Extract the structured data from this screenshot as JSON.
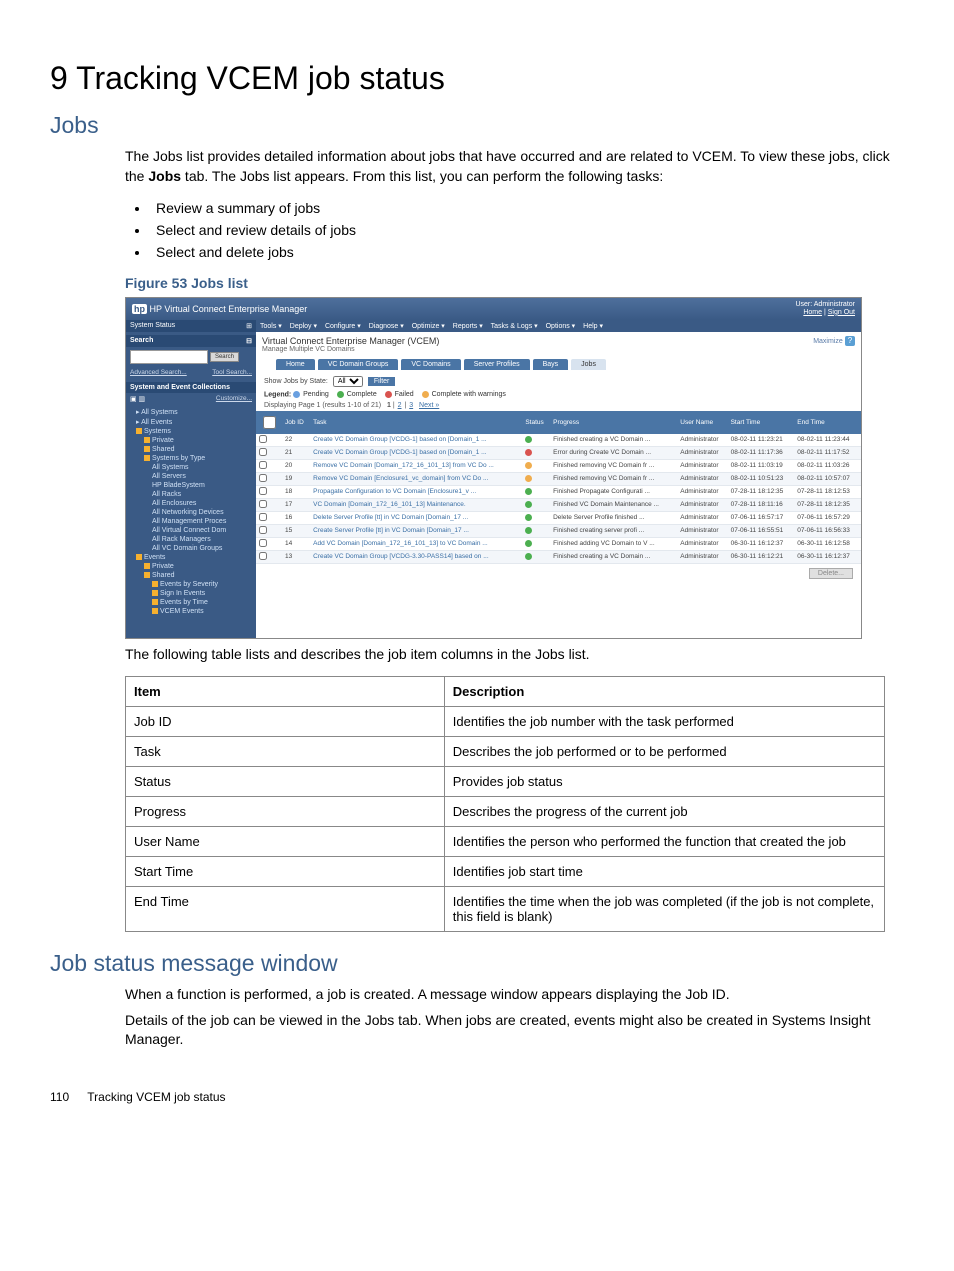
{
  "page": {
    "title": "9 Tracking VCEM job status",
    "section_jobs": "Jobs",
    "intro": "The Jobs list provides detailed information about jobs that have occurred and are related to VCEM. To view these jobs, click the ",
    "intro_bold": "Jobs",
    "intro2": " tab. The Jobs list appears. From this list, you can perform the following tasks:",
    "tasks": [
      "Review a summary of jobs",
      "Select and review details of jobs",
      "Select and delete jobs"
    ],
    "figure_caption": "Figure 53 Jobs list",
    "after_figure": "The following table lists and describes the job item columns in the Jobs list.",
    "section_status": "Job status message window",
    "status_p1": "When a function is performed, a job is created. A message window appears displaying the Job ID.",
    "status_p2": "Details of the job can be viewed in the Jobs tab. When jobs are created, events might also be created in Systems Insight Manager.",
    "footer_num": "110",
    "footer_text": "Tracking VCEM job status"
  },
  "desc_table": {
    "h1": "Item",
    "h2": "Description",
    "rows": [
      {
        "item": "Job ID",
        "desc": "Identifies the job number with the task performed"
      },
      {
        "item": "Task",
        "desc": "Describes the job performed or to be performed"
      },
      {
        "item": "Status",
        "desc": "Provides job status"
      },
      {
        "item": "Progress",
        "desc": "Describes the progress of the current job"
      },
      {
        "item": "User Name",
        "desc": "Identifies the person who performed the function that created the job"
      },
      {
        "item": "Start Time",
        "desc": "Identifies job start time"
      },
      {
        "item": "End Time",
        "desc": "Identifies the time when the job was completed (if the job is not complete, this field is blank)"
      }
    ]
  },
  "app": {
    "title": "HP Virtual Connect Enterprise Manager",
    "user_label": "User: Administrator",
    "home_link": "Home",
    "signout_link": "Sign Out",
    "system_status": "System Status",
    "menubar": [
      "Tools ▾",
      "Deploy ▾",
      "Configure ▾",
      "Diagnose ▾",
      "Optimize ▾",
      "Reports ▾",
      "Tasks & Logs ▾",
      "Options ▾",
      "Help ▾"
    ],
    "sidebar": {
      "search_label": "Search",
      "search_btn": "Search",
      "adv_search": "Advanced Search...",
      "tool_search": "Tool Search...",
      "collections_label": "System and Event Collections",
      "customize": "Customize...",
      "all_systems": "All Systems",
      "all_events": "All Events",
      "systems": "Systems",
      "private": "Private",
      "shared": "Shared",
      "systems_by_type": "Systems by Type",
      "nodes": [
        "All Systems",
        "All Servers",
        "HP BladeSystem",
        "All Racks",
        "All Enclosures",
        "All Networking Devices",
        "All Management Proces",
        "All Virtual Connect Dom",
        "All Rack Managers",
        "All VC Domain Groups"
      ],
      "events": "Events",
      "events_private": "Private",
      "events_shared": "Shared",
      "events_by_severity": "Events by Severity",
      "sign_in_events": "Sign In Events",
      "events_by_time": "Events by Time",
      "vcem_events": "VCEM Events"
    },
    "main": {
      "title": "Virtual Connect Enterprise Manager (VCEM)",
      "subtitle": "Manage Multiple VC Domains",
      "maximize": "Maximize",
      "tabs": [
        "Home",
        "VC Domain Groups",
        "VC Domains",
        "Server Profiles",
        "Bays",
        "Jobs"
      ],
      "active_tab": 5,
      "show_label": "Show Jobs by State:",
      "show_value": "All",
      "filter_btn": "Filter",
      "legend_label": "Legend:",
      "legend_items": [
        "Pending",
        "Complete",
        "Failed",
        "Complete with warnings"
      ],
      "pager_text": "Displaying Page 1 (results 1-10 of 21)",
      "pager_links": [
        "1",
        "2",
        "3",
        "Next »"
      ],
      "cols": [
        "Job ID",
        "Task",
        "Status",
        "Progress",
        "User Name",
        "Start Time",
        "End Time"
      ],
      "rows": [
        {
          "id": "22",
          "task": "Create VC Domain Group [VCDG-1] based on [Domain_1 ...",
          "status": "complete",
          "progress": "Finished creating a VC Domain ...",
          "user": "Administrator",
          "start": "08-02-11 11:23:21",
          "end": "08-02-11 11:23:44"
        },
        {
          "id": "21",
          "task": "Create VC Domain Group [VCDG-1] based on [Domain_1 ...",
          "status": "failed",
          "progress": "Error during Create VC Domain ...",
          "user": "Administrator",
          "start": "08-02-11 11:17:36",
          "end": "08-02-11 11:17:52"
        },
        {
          "id": "20",
          "task": "Remove VC Domain [Domain_172_16_101_13] from VC Do ...",
          "status": "warn",
          "progress": "Finished removing VC Domain fr ...",
          "user": "Administrator",
          "start": "08-02-11 11:03:19",
          "end": "08-02-11 11:03:26"
        },
        {
          "id": "19",
          "task": "Remove VC Domain [Enclosure1_vc_domain] from VC Do ...",
          "status": "warn",
          "progress": "Finished removing VC Domain fr ...",
          "user": "Administrator",
          "start": "08-02-11 10:51:23",
          "end": "08-02-11 10:57:07"
        },
        {
          "id": "18",
          "task": "Propagate Configuration to VC Domain [Enclosure1_v ...",
          "status": "complete",
          "progress": "Finished Propagate Configurati ...",
          "user": "Administrator",
          "start": "07-28-11 18:12:35",
          "end": "07-28-11 18:12:53"
        },
        {
          "id": "17",
          "task": "VC Domain [Domain_172_16_101_13] Maintenance.",
          "status": "complete",
          "progress": "Finished VC Domain Maintenance ...",
          "user": "Administrator",
          "start": "07-28-11 18:11:16",
          "end": "07-28-11 18:12:35"
        },
        {
          "id": "16",
          "task": "Delete Server Profile [tt] in VC Domain [Domain_17 ...",
          "status": "complete",
          "progress": "Delete Server Profile finished ...",
          "user": "Administrator",
          "start": "07-06-11 16:57:17",
          "end": "07-06-11 16:57:29"
        },
        {
          "id": "15",
          "task": "Create Server Profile [tt] in VC Domain [Domain_17 ...",
          "status": "complete",
          "progress": "Finished creating server profi ...",
          "user": "Administrator",
          "start": "07-06-11 16:55:51",
          "end": "07-06-11 16:56:33"
        },
        {
          "id": "14",
          "task": "Add VC Domain [Domain_172_16_101_13] to VC Domain ...",
          "status": "complete",
          "progress": "Finished adding VC Domain to V ...",
          "user": "Administrator",
          "start": "06-30-11 16:12:37",
          "end": "06-30-11 16:12:58"
        },
        {
          "id": "13",
          "task": "Create VC Domain Group [VCDG-3.30-PASS14] based on ...",
          "status": "complete",
          "progress": "Finished creating a VC Domain ...",
          "user": "Administrator",
          "start": "06-30-11 16:12:21",
          "end": "06-30-11 16:12:37"
        }
      ],
      "delete_btn": "Delete..."
    }
  }
}
